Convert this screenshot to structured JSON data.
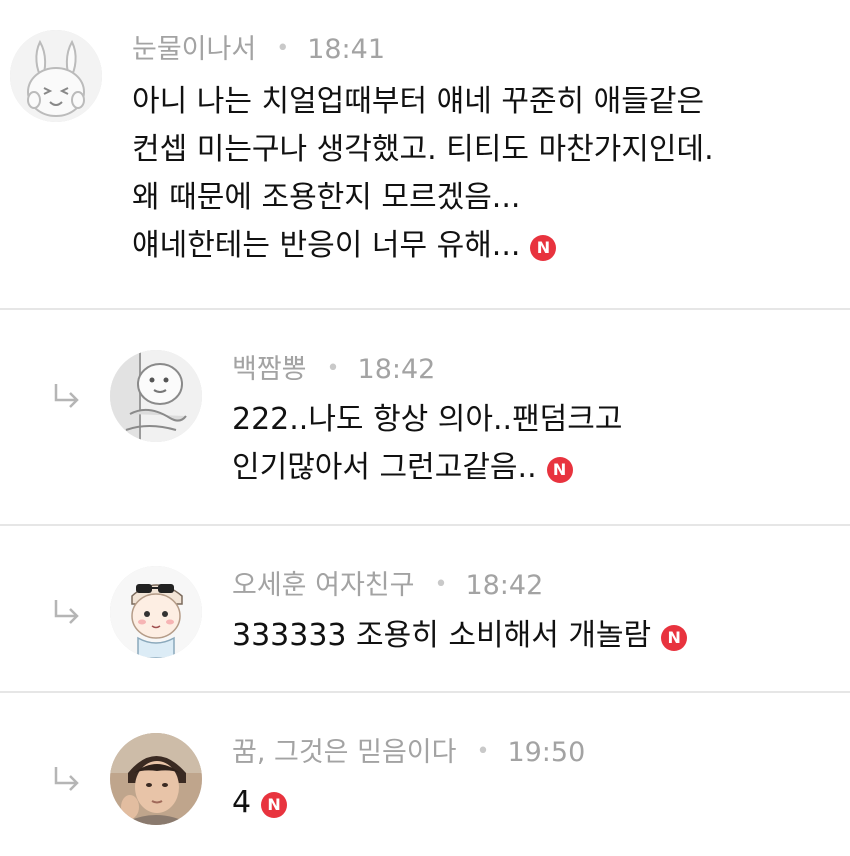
{
  "comments": [
    {
      "author": "눈물이나서",
      "separator": "•",
      "time": "18:41",
      "is_reply": false,
      "avatar": "bunny-face-icon",
      "lines": [
        "아니 나는 치얼업때부터 얘네 꾸준히 애들같은",
        "컨셉 미는구나 생각했고. 티티도 마찬가지인데.",
        "왜 때문에 조용한지 모르겠음...",
        "얘네한테는 반응이 너무 유해..."
      ],
      "badge": "N"
    },
    {
      "author": "백짬뽕",
      "separator": "•",
      "time": "18:42",
      "is_reply": true,
      "avatar": "peeking-character-icon",
      "lines": [
        "222..나도 항상 의아..팬덤크고",
        "인기많아서 그런고같음.."
      ],
      "badge": "N"
    },
    {
      "author": "오세훈 여자친구",
      "separator": "•",
      "time": "18:42",
      "is_reply": true,
      "avatar": "cartoon-boy-sunglasses-icon",
      "lines": [
        "333333 조용히 소비해서 개놀람"
      ],
      "badge": "N"
    },
    {
      "author": "꿈, 그것은 믿음이다",
      "separator": "•",
      "time": "19:50",
      "is_reply": true,
      "avatar": "profile-photo",
      "lines": [
        "4"
      ],
      "badge": "N"
    }
  ],
  "colors": {
    "badge": "#e8333e",
    "meta_text": "#a3a3a3",
    "body_text": "#111111",
    "divider": "#e6e6e6"
  }
}
